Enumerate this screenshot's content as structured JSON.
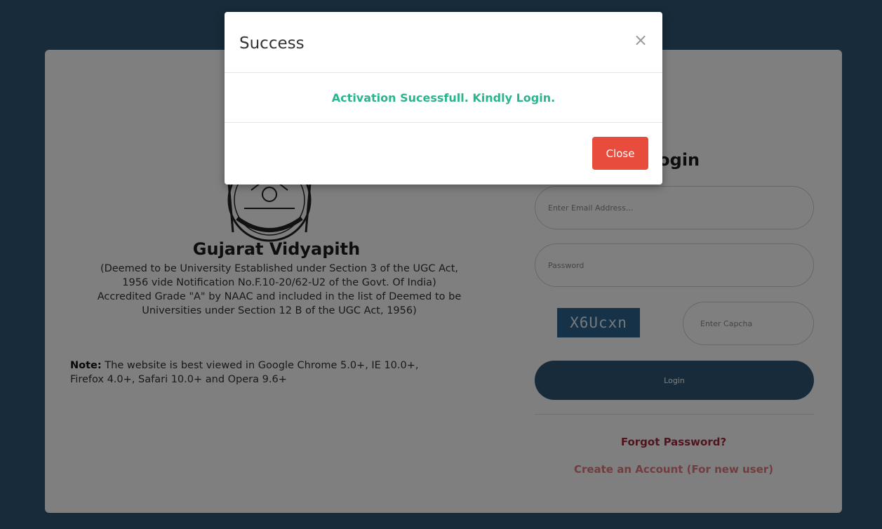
{
  "colors": {
    "background": "#2e5775",
    "card": "#ffffff",
    "login_button": "#2e5775",
    "forgot_link": "#a02a3c",
    "create_link": "#e37a7f",
    "success_text": "#2bb58f",
    "close_button": "#e74c3c",
    "captcha_bg": "#2b6592"
  },
  "university": {
    "seal_icon": "university-seal-icon",
    "name": "Gujarat Vidyapith",
    "description_lines": [
      "(Deemed to be University Established under Section 3 of the UGC Act,",
      "1956 vide Notification No.F.10-20/62-U2 of the Govt. Of India)",
      "Accredited Grade \"A\" by NAAC and included in the list of Deemed to be",
      "Universities under Section 12 B of the UGC Act, 1956)"
    ],
    "note_label": "Note:",
    "note_text": " The website is best viewed in Google Chrome 5.0+, IE 10.0+,",
    "note_text_line2": "Firefox 4.0+, Safari 10.0+ and Opera 9.6+"
  },
  "login": {
    "title": "Login",
    "email_placeholder": "Enter Email Address...",
    "password_placeholder": "Password",
    "captcha_code": "X6Ucxn",
    "captcha_placeholder": "Enter Capcha",
    "button_label": "Login",
    "forgot_password": "Forgot Password?",
    "create_account": "Create an Account (For new user)"
  },
  "modal": {
    "title": "Success",
    "close_symbol": "×",
    "message": "Activation Sucessfull. Kindly Login.",
    "close_button": "Close"
  }
}
